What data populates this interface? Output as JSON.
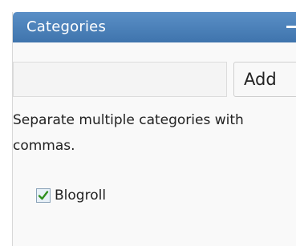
{
  "panel": {
    "title": "Categories"
  },
  "new_category": {
    "value": "",
    "placeholder": "",
    "add_label": "Add"
  },
  "help_text": "Separate multiple categories with commas.",
  "categories": [
    {
      "label": "Blogroll",
      "checked": true
    }
  ],
  "colors": {
    "header": "#4b7fb8",
    "checkmark": "#2f8f1f"
  },
  "icons": {
    "header": "collapse-icon",
    "category_check": "checkmark-icon"
  }
}
